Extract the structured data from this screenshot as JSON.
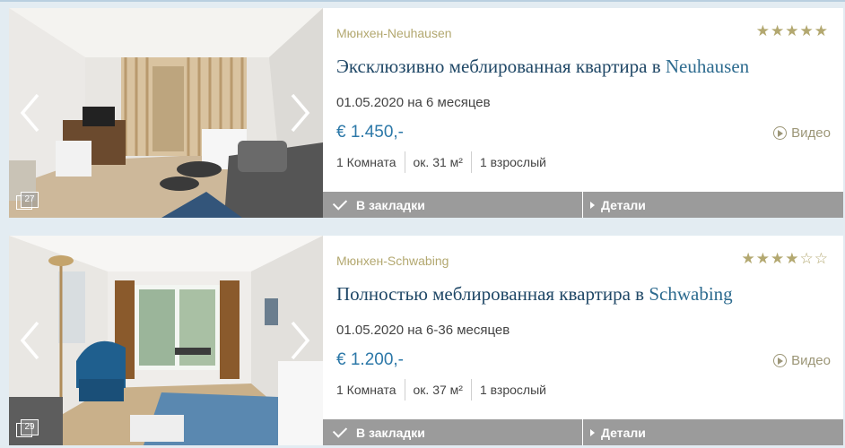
{
  "listings": [
    {
      "location": "Мюнхен-Neuhausen",
      "rating": 4.5,
      "stars": "★★★★★",
      "title_main": "Эксклюзивно меблированная квартира в ",
      "title_place": "Neuhausen",
      "dates": "01.05.2020 на 6 месяцев",
      "price": "€ 1.450,-",
      "video_label": "Видео",
      "rooms": "1 Комната",
      "area": "ок. 31 м²",
      "guests": "1 взрослый",
      "photo_count": "27",
      "bookmark_label": "В закладки",
      "details_label": "Детали"
    },
    {
      "location": "Мюнхен-Schwabing",
      "rating": 3.5,
      "stars": "★★★★☆☆",
      "title_main": "Полностью меблированная квартира в ",
      "title_place": "Schwabing",
      "dates": "01.05.2020 на 6-36 месяцев",
      "price": "€ 1.200,-",
      "video_label": "Видео",
      "rooms": "1 Комната",
      "area": "ок. 37 м²",
      "guests": "1 взрослый",
      "photo_count": "29",
      "bookmark_label": "В закладки",
      "details_label": "Детали"
    }
  ],
  "icons": {
    "prev": "chevron-left-icon",
    "next": "chevron-right-icon",
    "gallery": "gallery-icon",
    "video": "play-circle-icon",
    "bookmark": "checkmark-icon",
    "details": "caret-right-icon"
  },
  "colors": {
    "accent_gold": "#b3a870",
    "title_blue": "#1f4766",
    "price_blue": "#2c78a8",
    "button_gray": "#9b9b9b",
    "background": "#e3ecf2"
  }
}
